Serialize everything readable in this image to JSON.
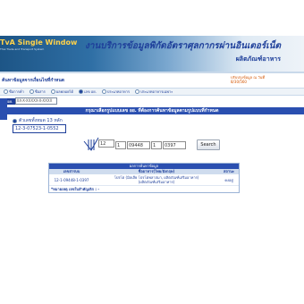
{
  "header": {
    "brand": "TvA Single Window",
    "brand_sub": "Thai Trade and Transport System",
    "title": "งานบริการข้อมูลพิกัดอัตราศุลกากรผ่านอินเตอร์เน็ต",
    "subtitle": "ผลิตภัณฑ์อาหาร"
  },
  "page": {
    "title": "ค้นหาข้อมูลจากเงื่อนไขที่กำหนด",
    "updated_label": "ปรับปรุงข้อมูล ณ วันที่",
    "updated_date": "8/30/560"
  },
  "search_options": [
    {
      "label": "ชื่อการค้า",
      "selected": false
    },
    {
      "label": "ชื่อสาร",
      "selected": false
    },
    {
      "label": "ผลพลอยได้",
      "selected": false
    },
    {
      "label": "เลข อย.",
      "selected": true
    },
    {
      "label": "ประเภทอาหาร",
      "selected": false
    },
    {
      "label": "ประเภทอาหารเฉพาะ",
      "selected": false
    }
  ],
  "top_input": {
    "tag": "เลขอย.",
    "value": "XX-X-XXXXX-X-XXXX"
  },
  "section_title": "กรุณาเลือกรูปแบบเลข อย. ที่ต้องการค้นหาข้อมูลตามรูปแบบที่กำหนด",
  "format_option": {
    "label": "ตัวเลขทั้งหมด 13 หลัก",
    "example": "12-3-07523-1-0552"
  },
  "fields": {
    "f1": "12",
    "f2": "1",
    "f3": "09448",
    "f4": "1",
    "f5": "0397"
  },
  "search_button": "Search",
  "result": {
    "heading": "ผลการค้นหาข้อมูล",
    "columns": [
      "เลขสารบบ",
      "ชื่ออาหาร(ไทย/อังกฤษ)",
      "สถานะ"
    ],
    "rows": [
      {
        "code": "12-1-09448-1-0397",
        "name": "โปรโต (มิลเลีย โปรโตพลาสมา, ผลิตภัณฑ์เสริมอาหาร)",
        "name_line2": "(ผลิตภัณฑ์เสริมอาหาร)",
        "status": "คงอยู่"
      }
    ],
    "note": "*หมายเหตุ เลขใบสำคัญเลิก : -"
  }
}
